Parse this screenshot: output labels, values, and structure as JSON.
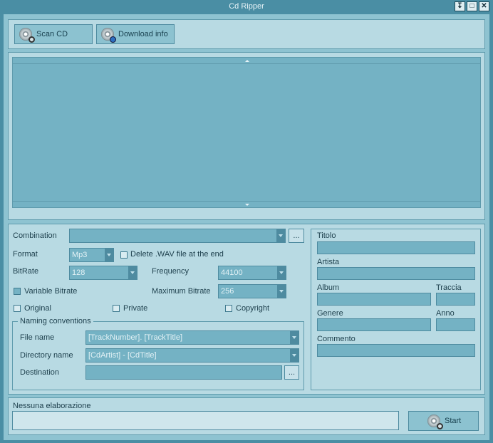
{
  "window": {
    "title": "Cd Ripper",
    "controls": [
      "minimize-icon",
      "maximize-icon",
      "close-icon"
    ]
  },
  "toolbar": {
    "scan_label": "Scan CD",
    "download_label": "Download info"
  },
  "form": {
    "combination_label": "Combination",
    "combination_value": "",
    "format_label": "Format",
    "format_value": "Mp3",
    "delete_wav_label": "Delete .WAV file at the end",
    "bitrate_label": "BitRate",
    "bitrate_value": "128",
    "frequency_label": "Frequency",
    "frequency_value": "44100",
    "variable_bitrate_label": "Variable Bitrate",
    "variable_bitrate_checked": true,
    "max_bitrate_label": "Maximum Bitrate",
    "max_bitrate_value": "256",
    "original_label": "Original",
    "private_label": "Private",
    "copyright_label": "Copyright",
    "naming_group_label": "Naming conventions",
    "file_name_label": "File name",
    "file_name_value": "[TrackNumber]. [TrackTitle]",
    "directory_name_label": "Directory name",
    "directory_name_value": "[CdArtist] - [CdTitle]",
    "destination_label": "Destination",
    "destination_value": "",
    "browse_label": "..."
  },
  "tags": {
    "titolo_label": "Titolo",
    "artista_label": "Artista",
    "album_label": "Album",
    "traccia_label": "Traccia",
    "genere_label": "Genere",
    "anno_label": "Anno",
    "commento_label": "Commento"
  },
  "status": {
    "text": "Nessuna elaborazione",
    "start_label": "Start"
  }
}
